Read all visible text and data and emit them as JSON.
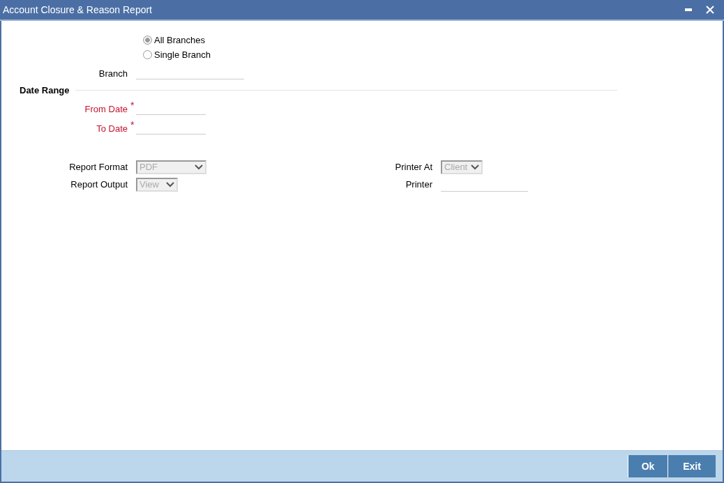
{
  "window": {
    "title": "Account Closure & Reason Report"
  },
  "branch_scope": [
    {
      "label": "All Branches",
      "selected": true
    },
    {
      "label": "Single Branch",
      "selected": false
    }
  ],
  "branch": {
    "label": "Branch"
  },
  "date_range": {
    "title": "Date Range",
    "fields": [
      {
        "label": "From Date",
        "required": true,
        "required_mark": "*"
      },
      {
        "label": "To Date",
        "required": true,
        "required_mark": "*"
      }
    ]
  },
  "report": {
    "left": [
      {
        "label": "Report Format",
        "kind": "select",
        "value": "PDF",
        "disabled": true
      },
      {
        "label": "Report Output",
        "kind": "select",
        "value": "View",
        "disabled": true
      }
    ],
    "right": [
      {
        "label": "Printer At",
        "kind": "select",
        "value": "Client",
        "disabled": true
      },
      {
        "label": "Printer",
        "kind": "text"
      }
    ]
  },
  "buttons": [
    "Ok",
    "Exit"
  ]
}
